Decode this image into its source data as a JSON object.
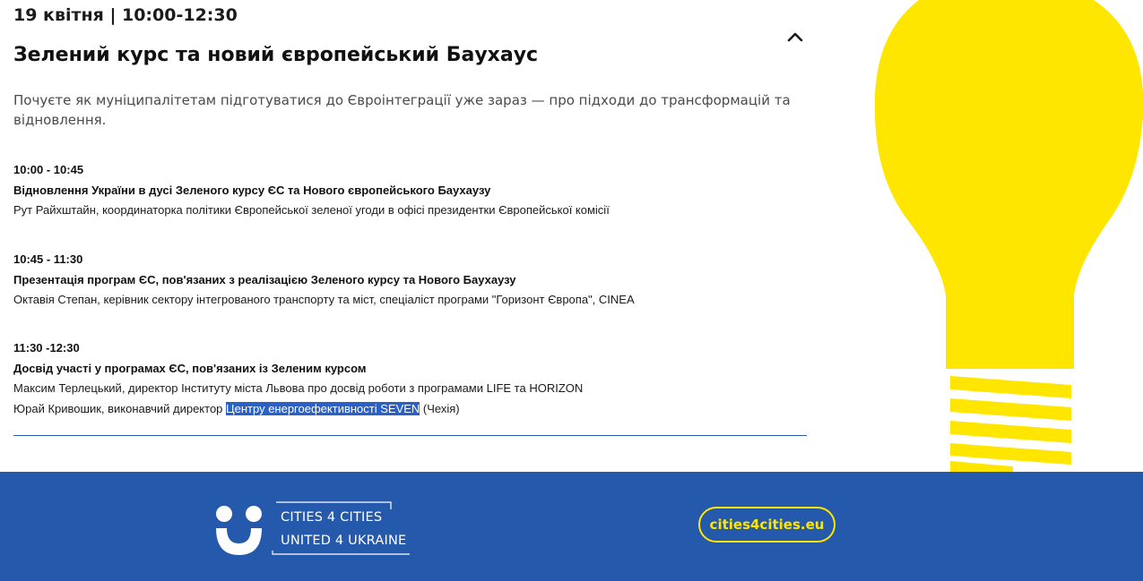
{
  "event": {
    "date_time": "19 квітня | 10:00-12:30",
    "title": "Зелений курс та новий європейський Баухаус",
    "intro": "Почуєте як муніципалітетам підготуватися до Євроінтеграції уже зараз — про підходи до трансформацій та відновлення.",
    "collapse_icon": "chevron-up-icon"
  },
  "sessions": [
    {
      "time": "10:00 - 10:45",
      "title": "Відновлення України в дусі Зеленого курсу ЄС та Нового європейського Баухаузу",
      "speakers": [
        "Рут Райхштайн, координаторка політики Європейської зеленої угоди в офісі президентки Європейської комісії"
      ]
    },
    {
      "time": "10:45 - 11:30",
      "title": "Презентація програм ЄС, пов'язаних з реалізацією Зеленого курсу та Нового Баухаузу",
      "speakers": [
        "Октавія Степан, керівник сектору інтегрованого транспорту та міст, спеціаліст програми \"Горизонт Європа\", CINEA"
      ]
    },
    {
      "time": "11:30 -12:30",
      "title": "Досвід участі у програмах ЄС, пов'язаних із Зеленим курсом",
      "speakers": [
        "Максим Терлецький, директор Інституту міста Львова про досвід роботи з програмами LIFE та HORIZON"
      ],
      "last_speaker": {
        "before": "Юрай Кривошик, виконавчий директор ",
        "selected": "Центру енергоефективності SEVEN",
        "after": " (Чехія)"
      }
    }
  ],
  "footer": {
    "logo_line1": "CITIES 4 CITIES",
    "logo_line2": "UNITED 4 UKRAINE",
    "website": "cities4cities.eu"
  },
  "colors": {
    "footer_bg": "#2559ab",
    "accent_yellow": "#ffe600",
    "selection": "#2a61c6"
  }
}
